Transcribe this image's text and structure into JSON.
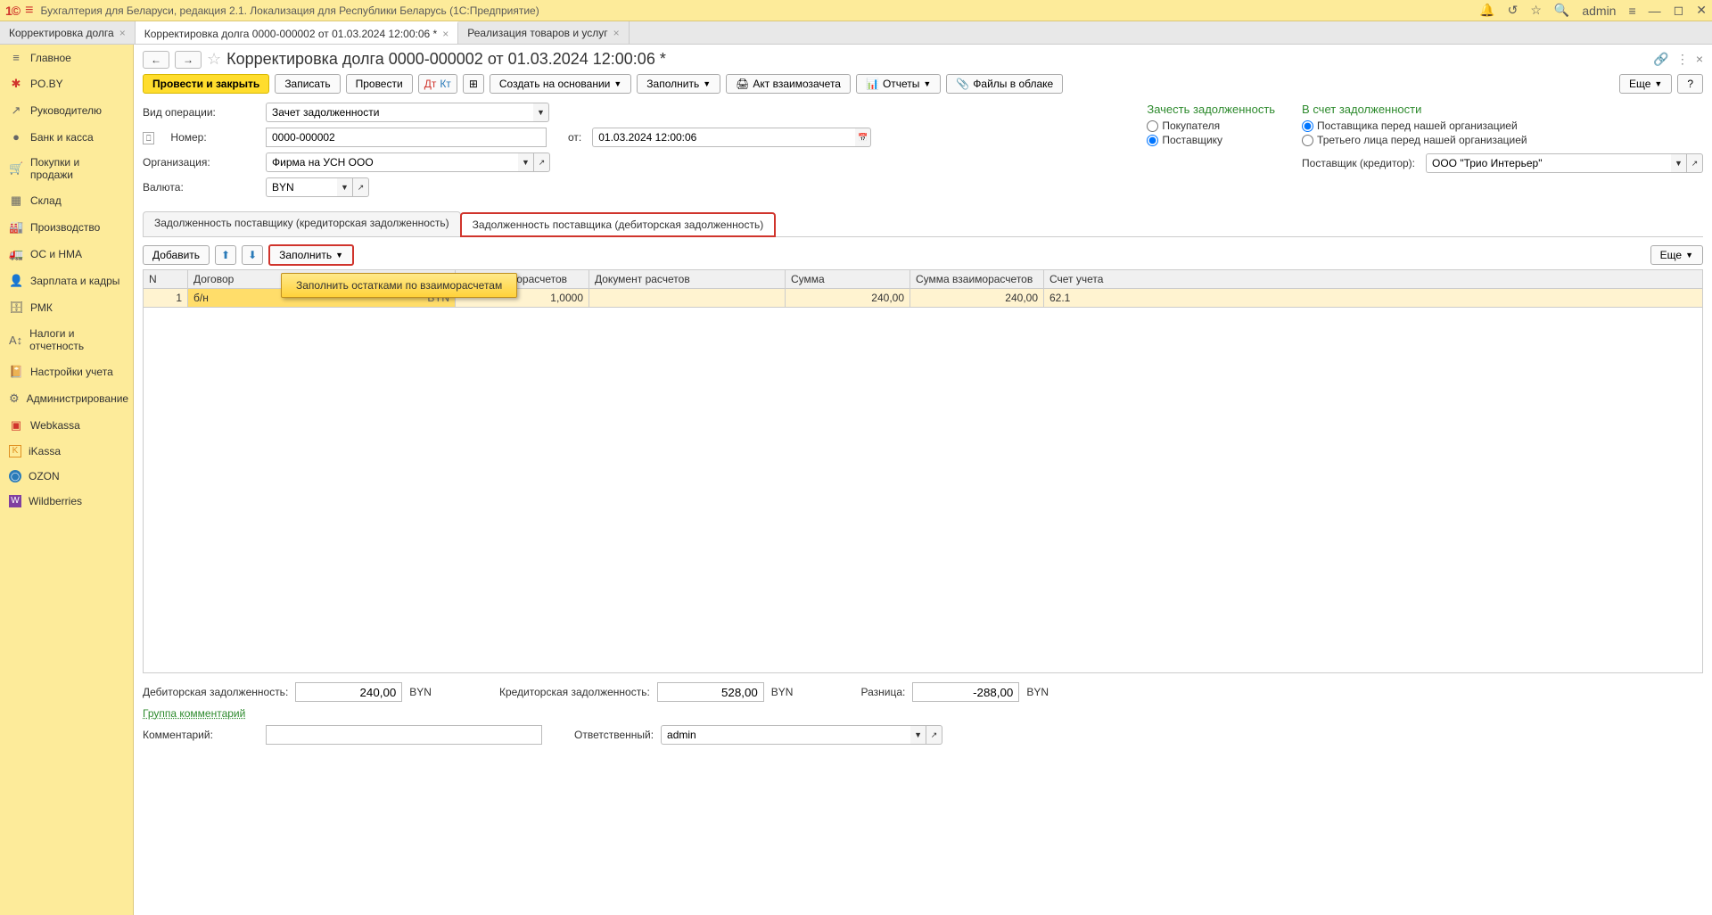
{
  "titlebar": {
    "app_title": "Бухгалтерия для Беларуси, редакция 2.1. Локализация для Республики Беларусь   (1С:Предприятие)",
    "user": "admin"
  },
  "tabs": [
    {
      "label": "Корректировка долга",
      "active": false
    },
    {
      "label": "Корректировка долга 0000-000002 от 01.03.2024 12:00:06 *",
      "active": true
    },
    {
      "label": "Реализация товаров и услуг",
      "active": false
    }
  ],
  "sidebar": [
    {
      "label": "Главное",
      "icon": "≡",
      "cls": "gray"
    },
    {
      "label": "PO.BY",
      "icon": "✱",
      "cls": "red"
    },
    {
      "label": "Руководителю",
      "icon": "↗",
      "cls": "gray"
    },
    {
      "label": "Банк и касса",
      "icon": "●",
      "cls": "gray"
    },
    {
      "label": "Покупки и продажи",
      "icon": "🛒",
      "cls": "gray"
    },
    {
      "label": "Склад",
      "icon": "▦",
      "cls": "gray"
    },
    {
      "label": "Производство",
      "icon": "🏭",
      "cls": "gray"
    },
    {
      "label": "ОС и НМА",
      "icon": "🚛",
      "cls": "gray"
    },
    {
      "label": "Зарплата и кадры",
      "icon": "👤",
      "cls": "gray"
    },
    {
      "label": "РМК",
      "icon": "🗄",
      "cls": "gray"
    },
    {
      "label": "Налоги и отчетность",
      "icon": "A↕",
      "cls": "gray"
    },
    {
      "label": "Настройки учета",
      "icon": "📔",
      "cls": "gray"
    },
    {
      "label": "Администрирование",
      "icon": "⚙",
      "cls": "gray"
    },
    {
      "label": "Webkassa",
      "icon": "▣",
      "cls": "red"
    },
    {
      "label": "iKassa",
      "icon": "K",
      "cls": "orange"
    },
    {
      "label": "OZON",
      "icon": "◯",
      "cls": "blue"
    },
    {
      "label": "Wildberries",
      "icon": "W",
      "cls": "purple"
    }
  ],
  "doc": {
    "title": "Корректировка долга 0000-000002 от 01.03.2024 12:00:06 *"
  },
  "toolbar": {
    "post_close": "Провести и закрыть",
    "save": "Записать",
    "post": "Провести",
    "create_based": "Создать на основании",
    "fill": "Заполнить",
    "act": "Акт взаимозачета",
    "reports": "Отчеты",
    "files": "Файлы в облаке",
    "more": "Еще",
    "help": "?"
  },
  "form": {
    "operation_label": "Вид операции:",
    "operation_value": "Зачет задолженности",
    "number_label": "Номер:",
    "number_value": "0000-000002",
    "from_label": "от:",
    "date_value": "01.03.2024 12:00:06",
    "org_label": "Организация:",
    "org_value": "Фирма на УСН ООО",
    "currency_label": "Валюта:",
    "currency_value": "BYN",
    "supplier_label": "Поставщик (кредитор):",
    "supplier_value": "ООО \"Трио Интерьер\""
  },
  "radios": {
    "offset_title": "Зачесть задолженность",
    "offset_buyer": "Покупателя",
    "offset_supplier": "Поставщику",
    "credit_title": "В счет задолженности",
    "credit_supplier_us": "Поставщика перед нашей организацией",
    "credit_third": "Третьего лица перед нашей организацией"
  },
  "subtabs": {
    "tab1": "Задолженность поставщику (кредиторская задолженность)",
    "tab2": "Задолженность поставщика (дебиторская задолженность)"
  },
  "tbltoolbar": {
    "add": "Добавить",
    "fill": "Заполнить",
    "more": "Еще",
    "dropdown_item": "Заполнить остатками по взаиморасчетам"
  },
  "table": {
    "headers": {
      "n": "N",
      "contract": "Договор",
      "rate": "Курс взаиморасчетов",
      "doc": "Документ расчетов",
      "sum": "Сумма",
      "sum_calc": "Сумма взаиморасчетов",
      "account": "Счет учета"
    },
    "row": {
      "n": "1",
      "contract": "б/н",
      "cur": "BYN",
      "rate": "1,0000",
      "doc": "",
      "sum": "240,00",
      "sum_calc": "240,00",
      "account": "62.1"
    }
  },
  "footer": {
    "debit_label": "Дебиторская задолженность:",
    "debit_value": "240,00",
    "debit_cur": "BYN",
    "credit_label": "Кредиторская задолженность:",
    "credit_value": "528,00",
    "credit_cur": "BYN",
    "diff_label": "Разница:",
    "diff_value": "-288,00",
    "diff_cur": "BYN",
    "group_link": "Группа комментарий",
    "comment_label": "Комментарий:",
    "comment_value": "",
    "responsible_label": "Ответственный:",
    "responsible_value": "admin"
  }
}
